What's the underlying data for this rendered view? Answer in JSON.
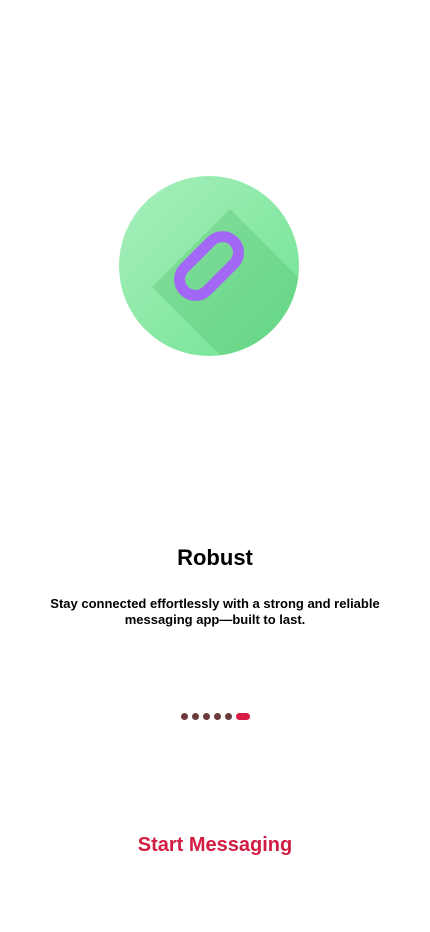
{
  "onboarding": {
    "hero_icon": "link-icon",
    "title": "Robust",
    "description": "Stay connected effortlessly with a strong and reliable messaging app—built to last.",
    "page_indicator": {
      "total": 6,
      "current": 6
    },
    "start_button_label": "Start Messaging"
  },
  "colors": {
    "accent": "#d11d42",
    "circle_green": "#7ee29a",
    "link_purple": "#a367f5",
    "dot_inactive": "#6b3a3a",
    "dot_active": "#d81b45"
  }
}
